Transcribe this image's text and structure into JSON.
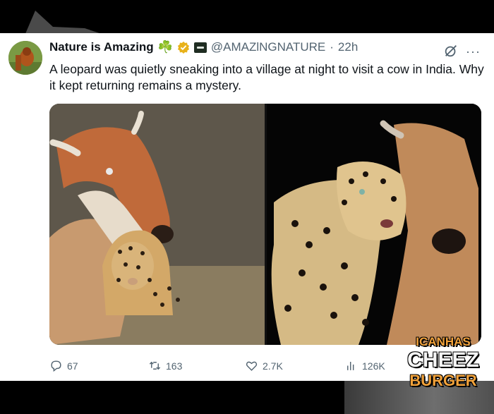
{
  "tweet": {
    "display_name": "Nature is Amazing",
    "handle": "@AMAZlNGNATURE",
    "separator": "·",
    "time": "22h",
    "text": "A leopard was quietly sneaking into a village at night to visit a cow in India. Why it kept returning remains a mystery."
  },
  "icons": {
    "clover": "☘️",
    "verified": "verified-badge-icon",
    "affiliate": "affiliate-badge-icon",
    "grok": "grok-icon",
    "more": "more-icon"
  },
  "actions": {
    "replies": "67",
    "reposts": "163",
    "likes": "2.7K",
    "views": "126K"
  },
  "colors": {
    "verified": "#e8b21a",
    "text": "#0f1419",
    "muted": "#536471",
    "watermark": "#f2a23a"
  },
  "watermark": {
    "line1": "ICANHAS",
    "line2": "CHEEZ",
    "line3": "BURGER"
  }
}
